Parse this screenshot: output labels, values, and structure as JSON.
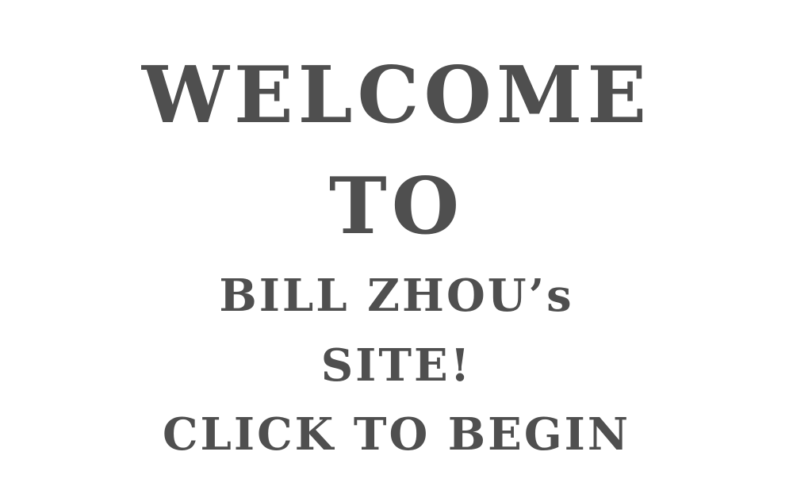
{
  "welcome": {
    "line1": "WELCOME",
    "line2": "TO",
    "line3": "BILL ZHOU’s",
    "line4": "SITE!",
    "cta": "CLICK TO BEGIN"
  },
  "colors": {
    "text": "#4f4f4f",
    "background": "#ffffff"
  }
}
